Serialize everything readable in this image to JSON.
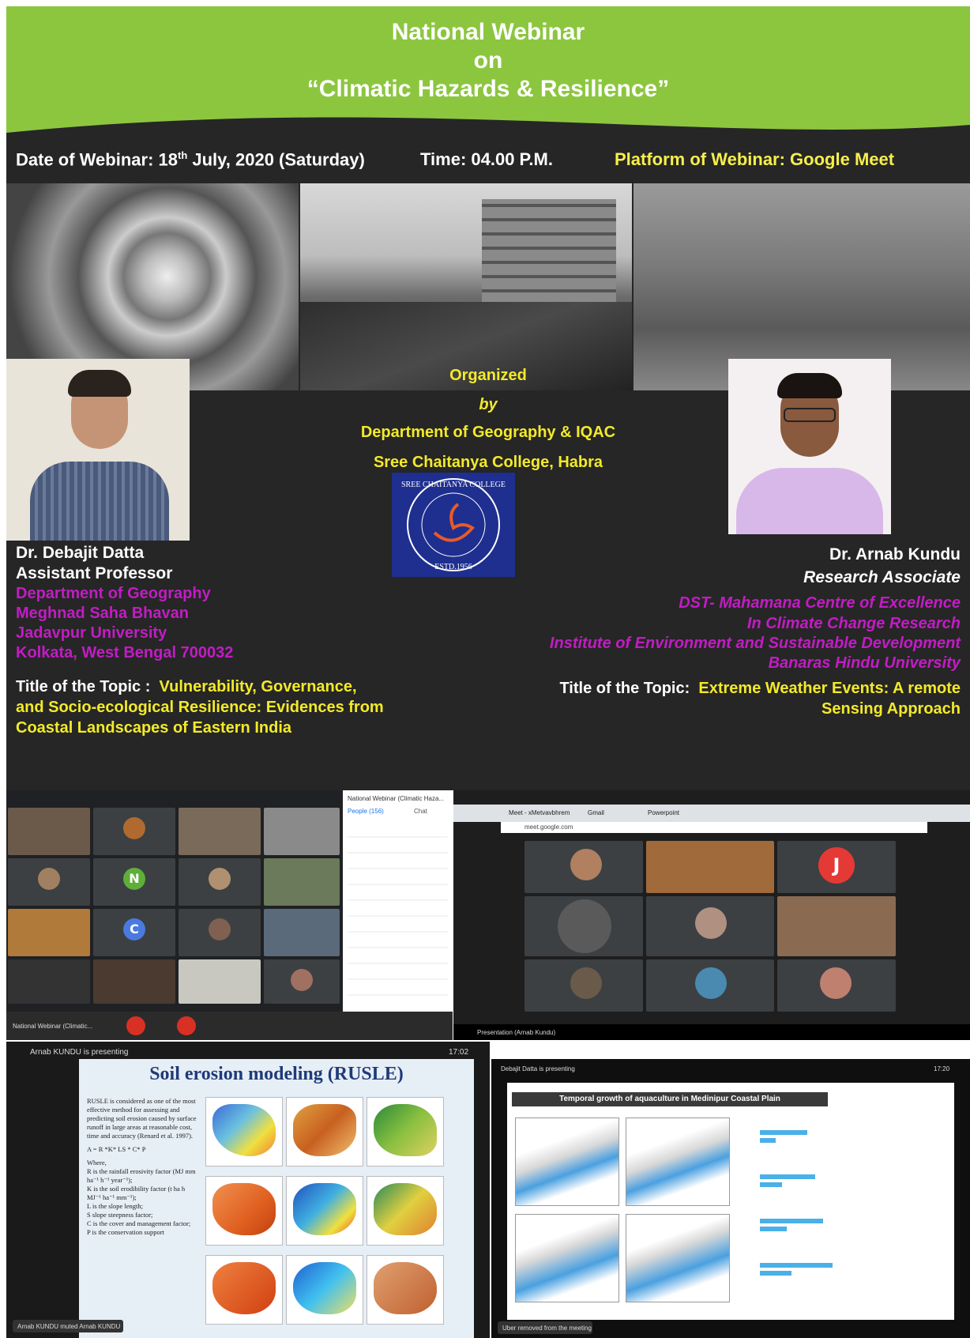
{
  "poster": {
    "title_line1": "National Webinar",
    "title_line2": "on",
    "title_line3": "“Climatic Hazards & Resilience”",
    "date_label": "Date of Webinar: 18",
    "date_sup": "th",
    "date_rest": " July, 2020 (Saturday)",
    "time": "Time: 04.00 P.M.",
    "platform": "Platform of Webinar: Google Meet",
    "organized": "Organized",
    "by": "by",
    "department": "Department of Geography & IQAC",
    "college": "Sree Chaitanya College, Habra",
    "logo_text_top": "SREE CHAITANYA COLLEGE",
    "logo_text_bottom": "ESTD.1956"
  },
  "speaker_left": {
    "name": "Dr. Debajit Datta",
    "role": "Assistant Professor",
    "aff1": "Department of Geography",
    "aff2": "Meghnad Saha Bhavan",
    "aff3": "Jadavpur University",
    "aff4": "Kolkata, West Bengal 700032",
    "topic_label": "Title of the Topic :",
    "topic_l1": "Vulnerability, Governance,",
    "topic_l2": "and Socio-ecological Resilience: Evidences from",
    "topic_l3": "Coastal Landscapes of Eastern India"
  },
  "speaker_right": {
    "name": "Dr. Arnab Kundu",
    "role": "Research Associate",
    "aff1": "DST- Mahamana Centre of Excellence",
    "aff2": "In Climate Change Research",
    "aff3": "Institute of Environment and Sustainable Development",
    "aff4": "Banaras Hindu University",
    "topic_label": "Title of the Topic:",
    "topic_l1": "Extreme Weather Events: A remote",
    "topic_l2": "Sensing Approach"
  },
  "meet_left": {
    "panel_title": "National Webinar (Climatic Haza...",
    "tab_people": "People (156)",
    "tab_chat": "Chat",
    "tile_letter_n": "N",
    "tile_letter_c": "C",
    "footer_text": "National Webinar (Climatic..."
  },
  "meet_right": {
    "tab1": "Meet - xMetvavbhrem",
    "tab2": "Gmail",
    "tab3": "Powerpoint",
    "url": "meet.google.com",
    "letter_j": "J",
    "footer_present": "Presentation (Arnab Kundu)"
  },
  "slide_left": {
    "presenter": "Arnab KUNDU is presenting",
    "slide_title": "Soil erosion modeling (RUSLE)",
    "bullet": "RUSLE is considered as one of the most effective method for assessing and predicting soil erosion caused by surface runoff in large areas at reasonable cost, time and accuracy (Renard et al. 1997).",
    "formula": "A = R *K* LS * C* P",
    "where": "Where,",
    "def_r": "R is the rainfall erosivity factor (MJ mm ha⁻¹ h⁻¹ year⁻¹);",
    "def_k": "K is the soil erodibility factor (t ha h MJ⁻¹ ha⁻¹ mm⁻¹);",
    "def_l": "L is the slope length;",
    "def_s": "S slope steepness factor;",
    "def_c": "C is the cover and management factor;",
    "def_p": "P is the conservation support",
    "footer": "Arnab KUNDU muted Arnab KUNDU",
    "time": "17:02"
  },
  "slide_right": {
    "presenter": "Debajit Datta is presenting",
    "slide_title": "Temporal growth of aquaculture in Medinipur Coastal Plain",
    "footer": "Uber removed from the meeting",
    "time": "17:20"
  }
}
